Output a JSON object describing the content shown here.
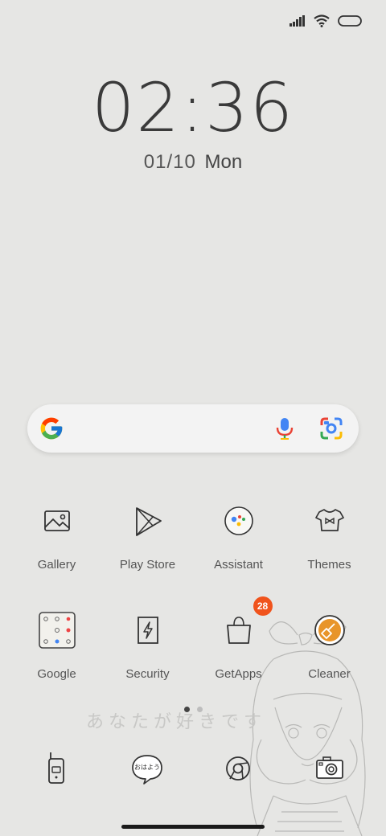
{
  "lockscreen": {
    "time": "02:36",
    "date": "01/10",
    "weekday": "Mon"
  },
  "wallpaper_text": "あなたが好きです",
  "search": {
    "provider_icon": "google-g-icon",
    "mic_icon": "mic-icon",
    "lens_icon": "lens-icon"
  },
  "apps_row1": [
    {
      "label": "Gallery",
      "icon": "gallery-icon"
    },
    {
      "label": "Play Store",
      "icon": "play-store-icon"
    },
    {
      "label": "Assistant",
      "icon": "assistant-icon"
    },
    {
      "label": "Themes",
      "icon": "themes-icon"
    }
  ],
  "apps_row2": [
    {
      "label": "Google",
      "icon": "google-folder-icon"
    },
    {
      "label": "Security",
      "icon": "security-icon"
    },
    {
      "label": "GetApps",
      "icon": "getapps-icon",
      "badge": "28"
    },
    {
      "label": "Cleaner",
      "icon": "cleaner-icon"
    }
  ],
  "dock": [
    {
      "icon": "phone-icon"
    },
    {
      "icon": "messages-icon",
      "text": "おはよう"
    },
    {
      "icon": "chrome-icon"
    },
    {
      "icon": "camera-icon"
    }
  ],
  "colors": {
    "background": "#e6e6e4",
    "badge": "#f0531c",
    "cleaner_accent": "#e8952a"
  }
}
